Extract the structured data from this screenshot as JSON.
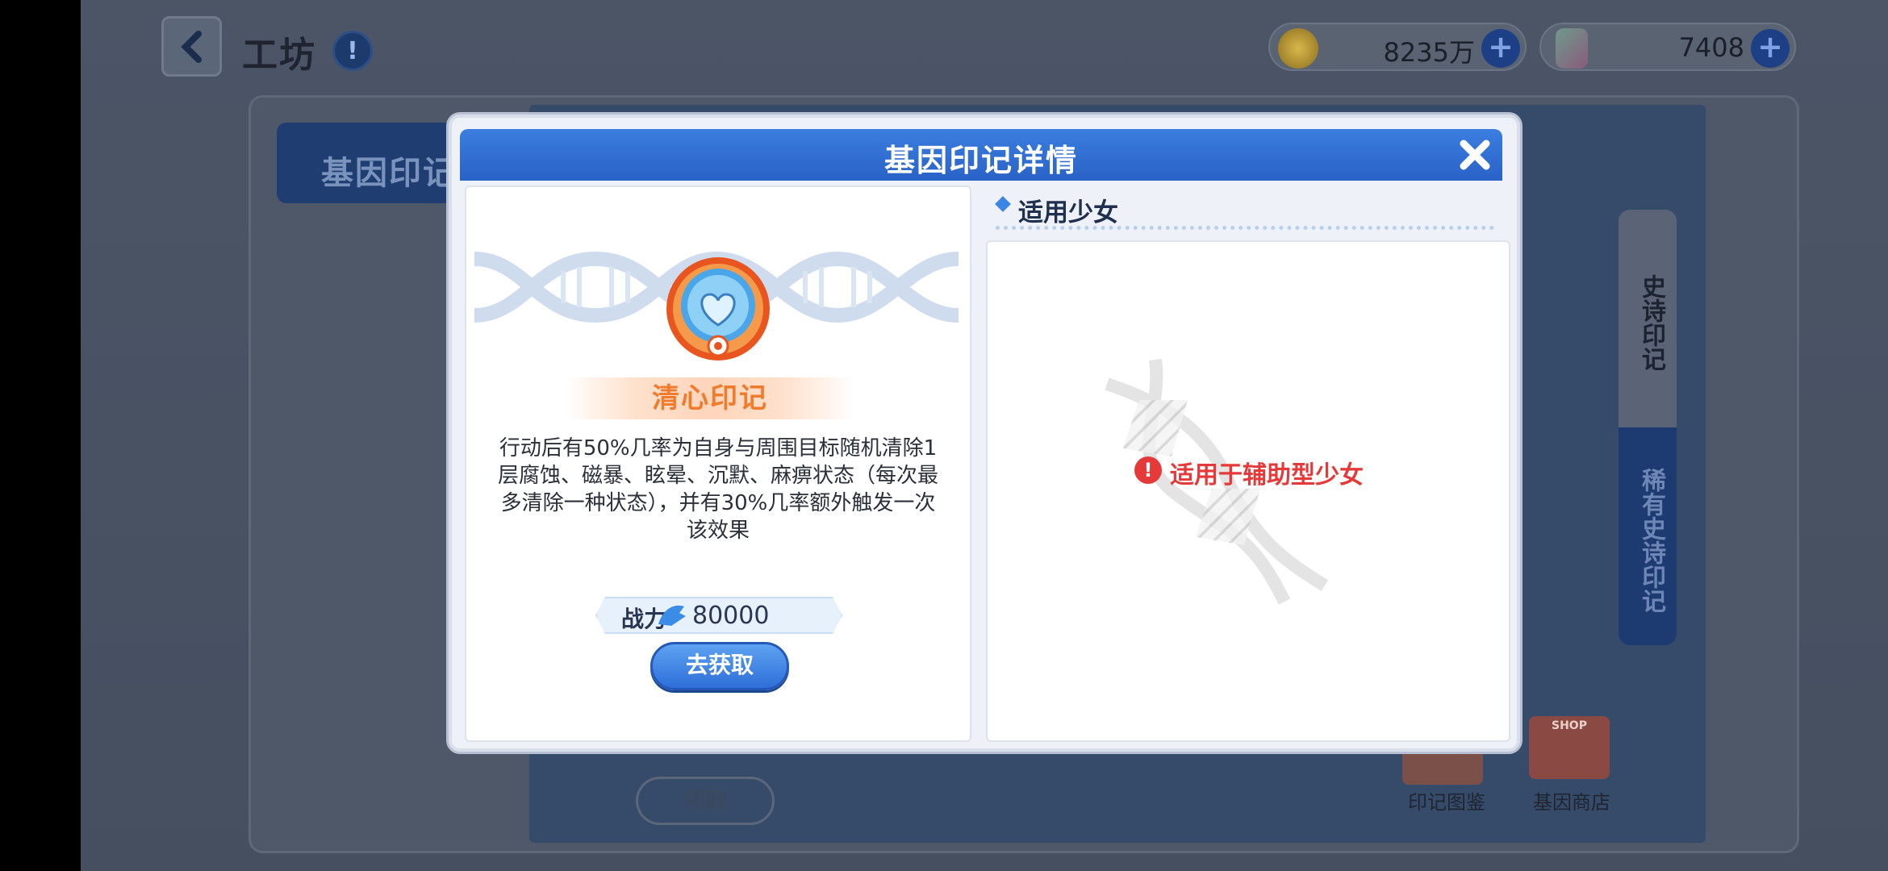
{
  "header": {
    "title": "工坊",
    "info_icon": "info-icon",
    "back_icon": "chevron-left-icon"
  },
  "currencies": [
    {
      "icon": "gold-coin-icon",
      "value": "8235万"
    },
    {
      "icon": "crystal-icon",
      "value": "7408"
    }
  ],
  "background": {
    "side_tab_label": "基因印记",
    "right_tabs": [
      "史诗印记",
      "稀有史诗印记"
    ],
    "bottom_button": "领取",
    "shortcuts": [
      "印记图鉴",
      "基因商店"
    ],
    "shop_sign": "SHOP"
  },
  "dialog": {
    "title": "基因印记详情",
    "close_icon": "close-icon",
    "item_name": "清心印记",
    "description": "行动后有50%几率为自身与周围目标随机清除1层腐蚀、磁暴、眩晕、沉默、麻痹状态（每次最多清除一种状态），并有30%几率额外触发一次该效果",
    "power_label": "战力",
    "power_value": "80000",
    "get_button": "去获取",
    "applicable_title": "适用少女",
    "applicable_note": "适用于辅助型少女"
  },
  "colors": {
    "header_blue": "#2f6fd4",
    "item_name_orange": "#f07b2c",
    "warning_red": "#e53a3a"
  }
}
